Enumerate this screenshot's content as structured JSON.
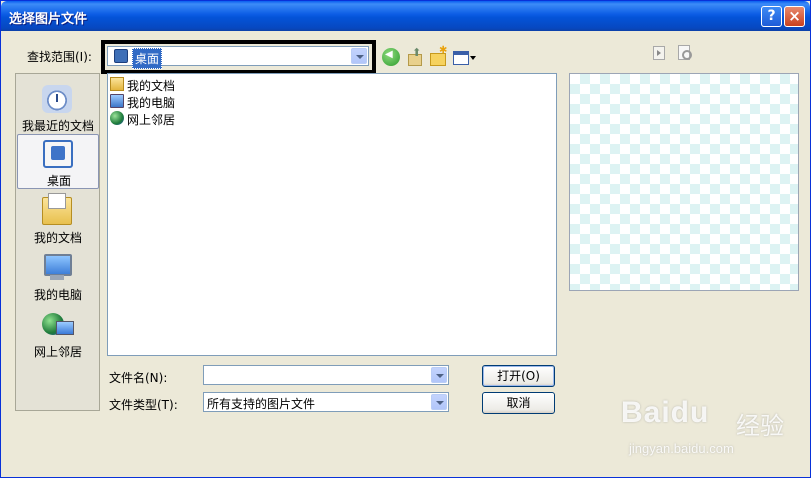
{
  "window": {
    "title": "选择图片文件",
    "help_label": "?",
    "close_label": "×"
  },
  "lookin": {
    "label": "查找范围(I):",
    "value": "桌面"
  },
  "places": [
    {
      "label": "我最近的文档",
      "icon": "recent-documents-icon"
    },
    {
      "label": "桌面",
      "icon": "desktop-icon",
      "selected": true
    },
    {
      "label": "我的文档",
      "icon": "my-documents-icon"
    },
    {
      "label": "我的电脑",
      "icon": "my-computer-icon"
    },
    {
      "label": "网上邻居",
      "icon": "network-places-icon"
    }
  ],
  "files": [
    {
      "name": "我的文档",
      "icon": "my-documents-icon"
    },
    {
      "name": "我的电脑",
      "icon": "my-computer-icon"
    },
    {
      "name": "网上邻居",
      "icon": "network-places-icon"
    }
  ],
  "filename": {
    "label": "文件名(N):",
    "value": ""
  },
  "filetype": {
    "label": "文件类型(T):",
    "value": "所有支持的图片文件"
  },
  "buttons": {
    "open": "打开(O)",
    "cancel": "取消"
  },
  "watermark": {
    "logo": "Baidu",
    "cn": "经验",
    "url": "jingyan.baidu.com"
  },
  "colors": {
    "titlebar": "#0A5FF0",
    "dialog_bg": "#ECE9D8",
    "selection": "#316AC5",
    "highlight_border": "#000000"
  }
}
